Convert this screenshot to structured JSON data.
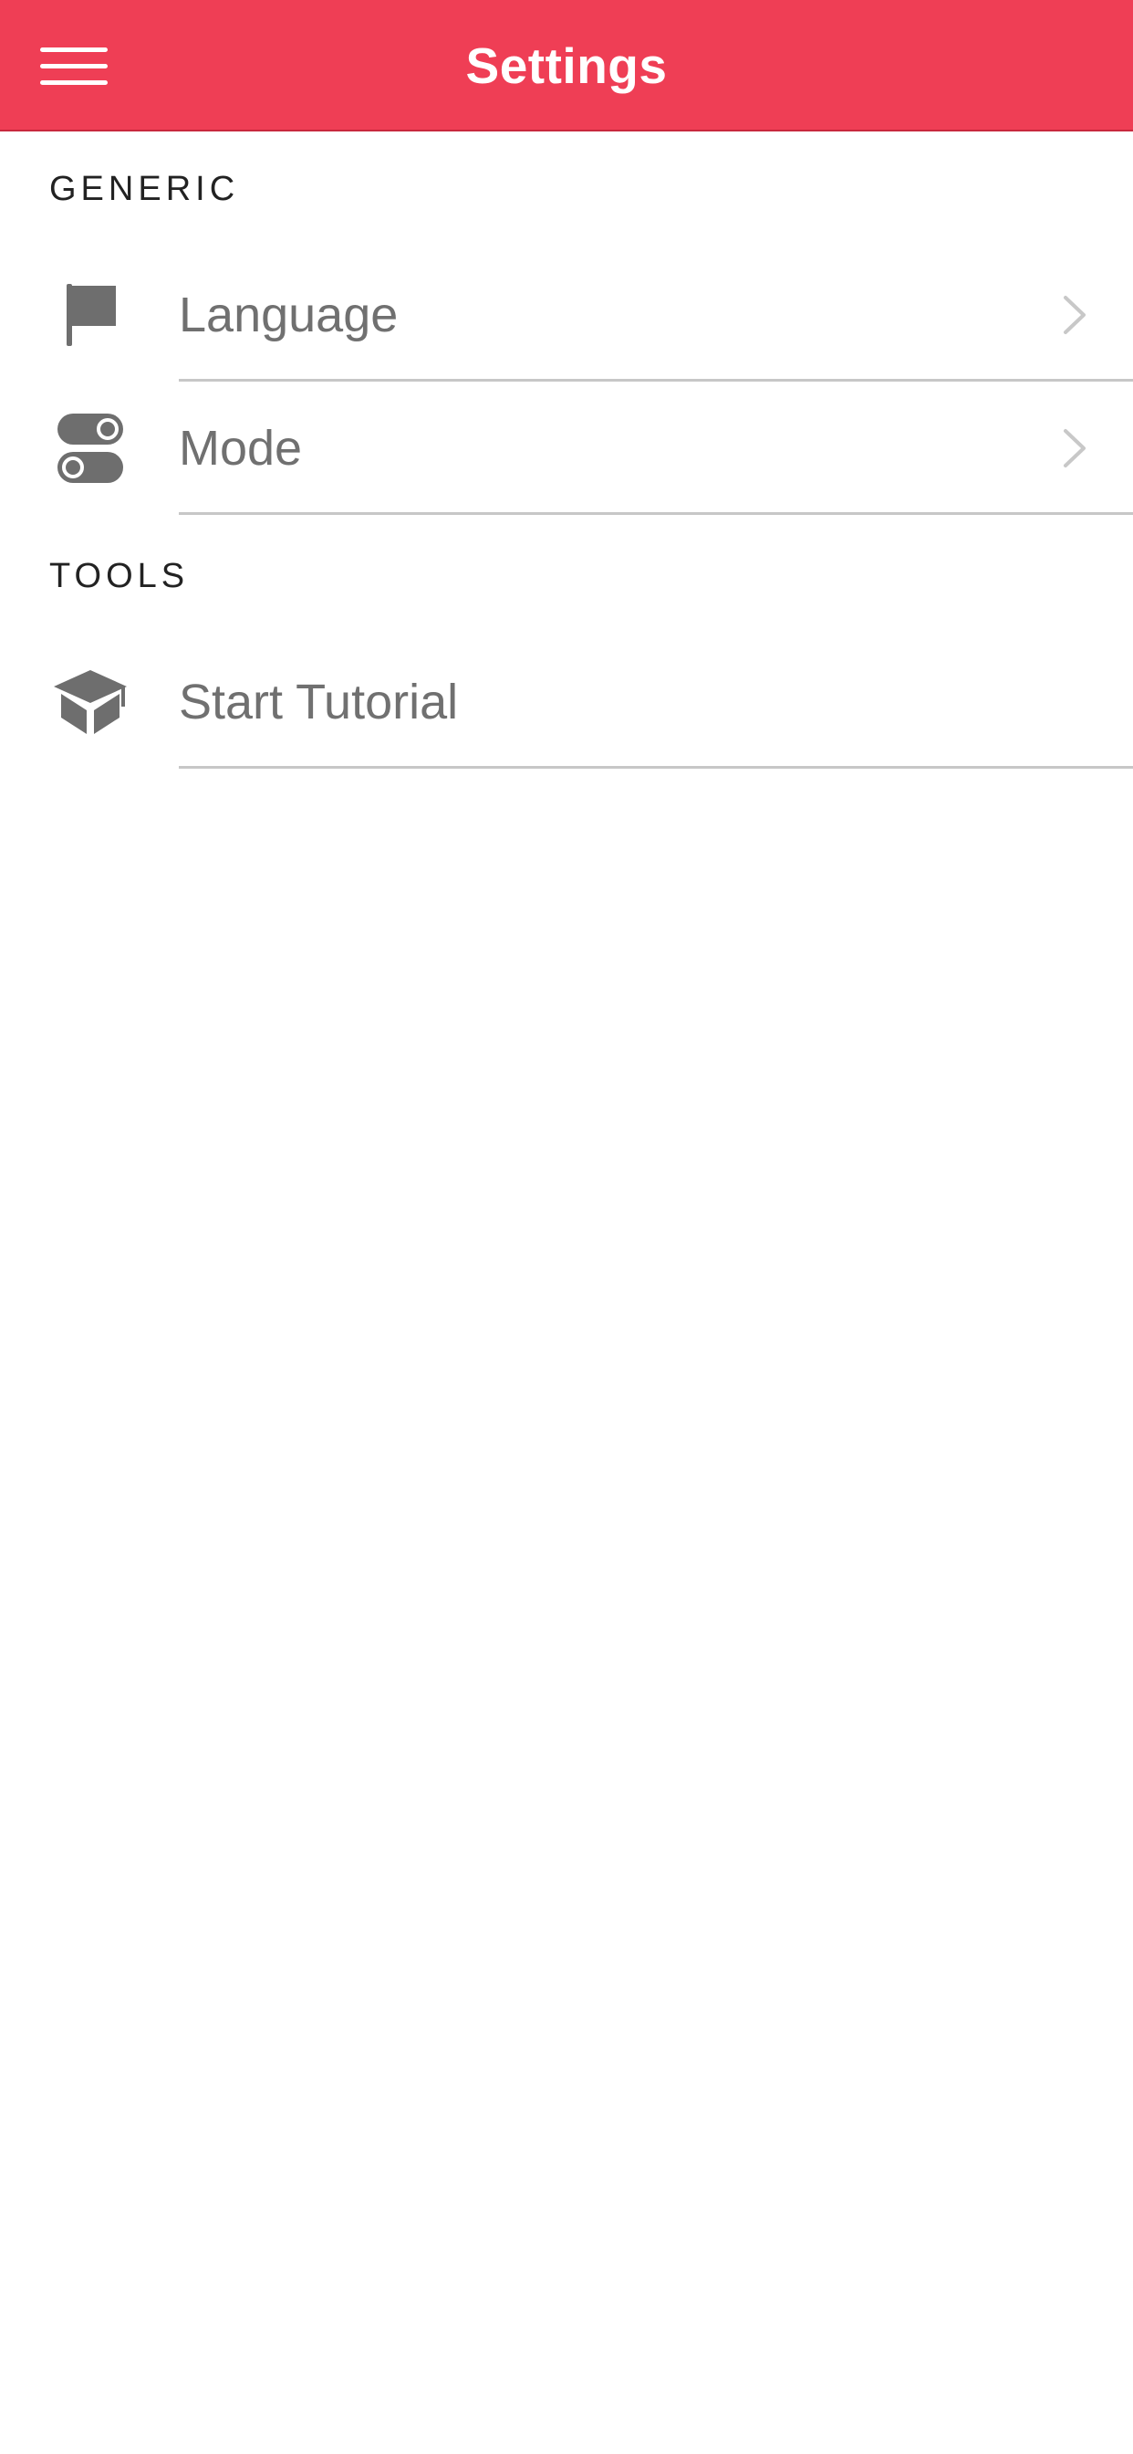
{
  "header": {
    "title": "Settings",
    "menu_icon": "hamburger-menu-icon",
    "background_color": "#ef3e55"
  },
  "sections": [
    {
      "title": "GENERIC",
      "items": [
        {
          "label": "Language",
          "icon": "flag-icon",
          "has_chevron": true
        },
        {
          "label": "Mode",
          "icon": "toggles-icon",
          "has_chevron": true
        }
      ]
    },
    {
      "title": "TOOLS",
      "items": [
        {
          "label": "Start Tutorial",
          "icon": "graduation-cap-icon",
          "has_chevron": false
        }
      ]
    }
  ]
}
